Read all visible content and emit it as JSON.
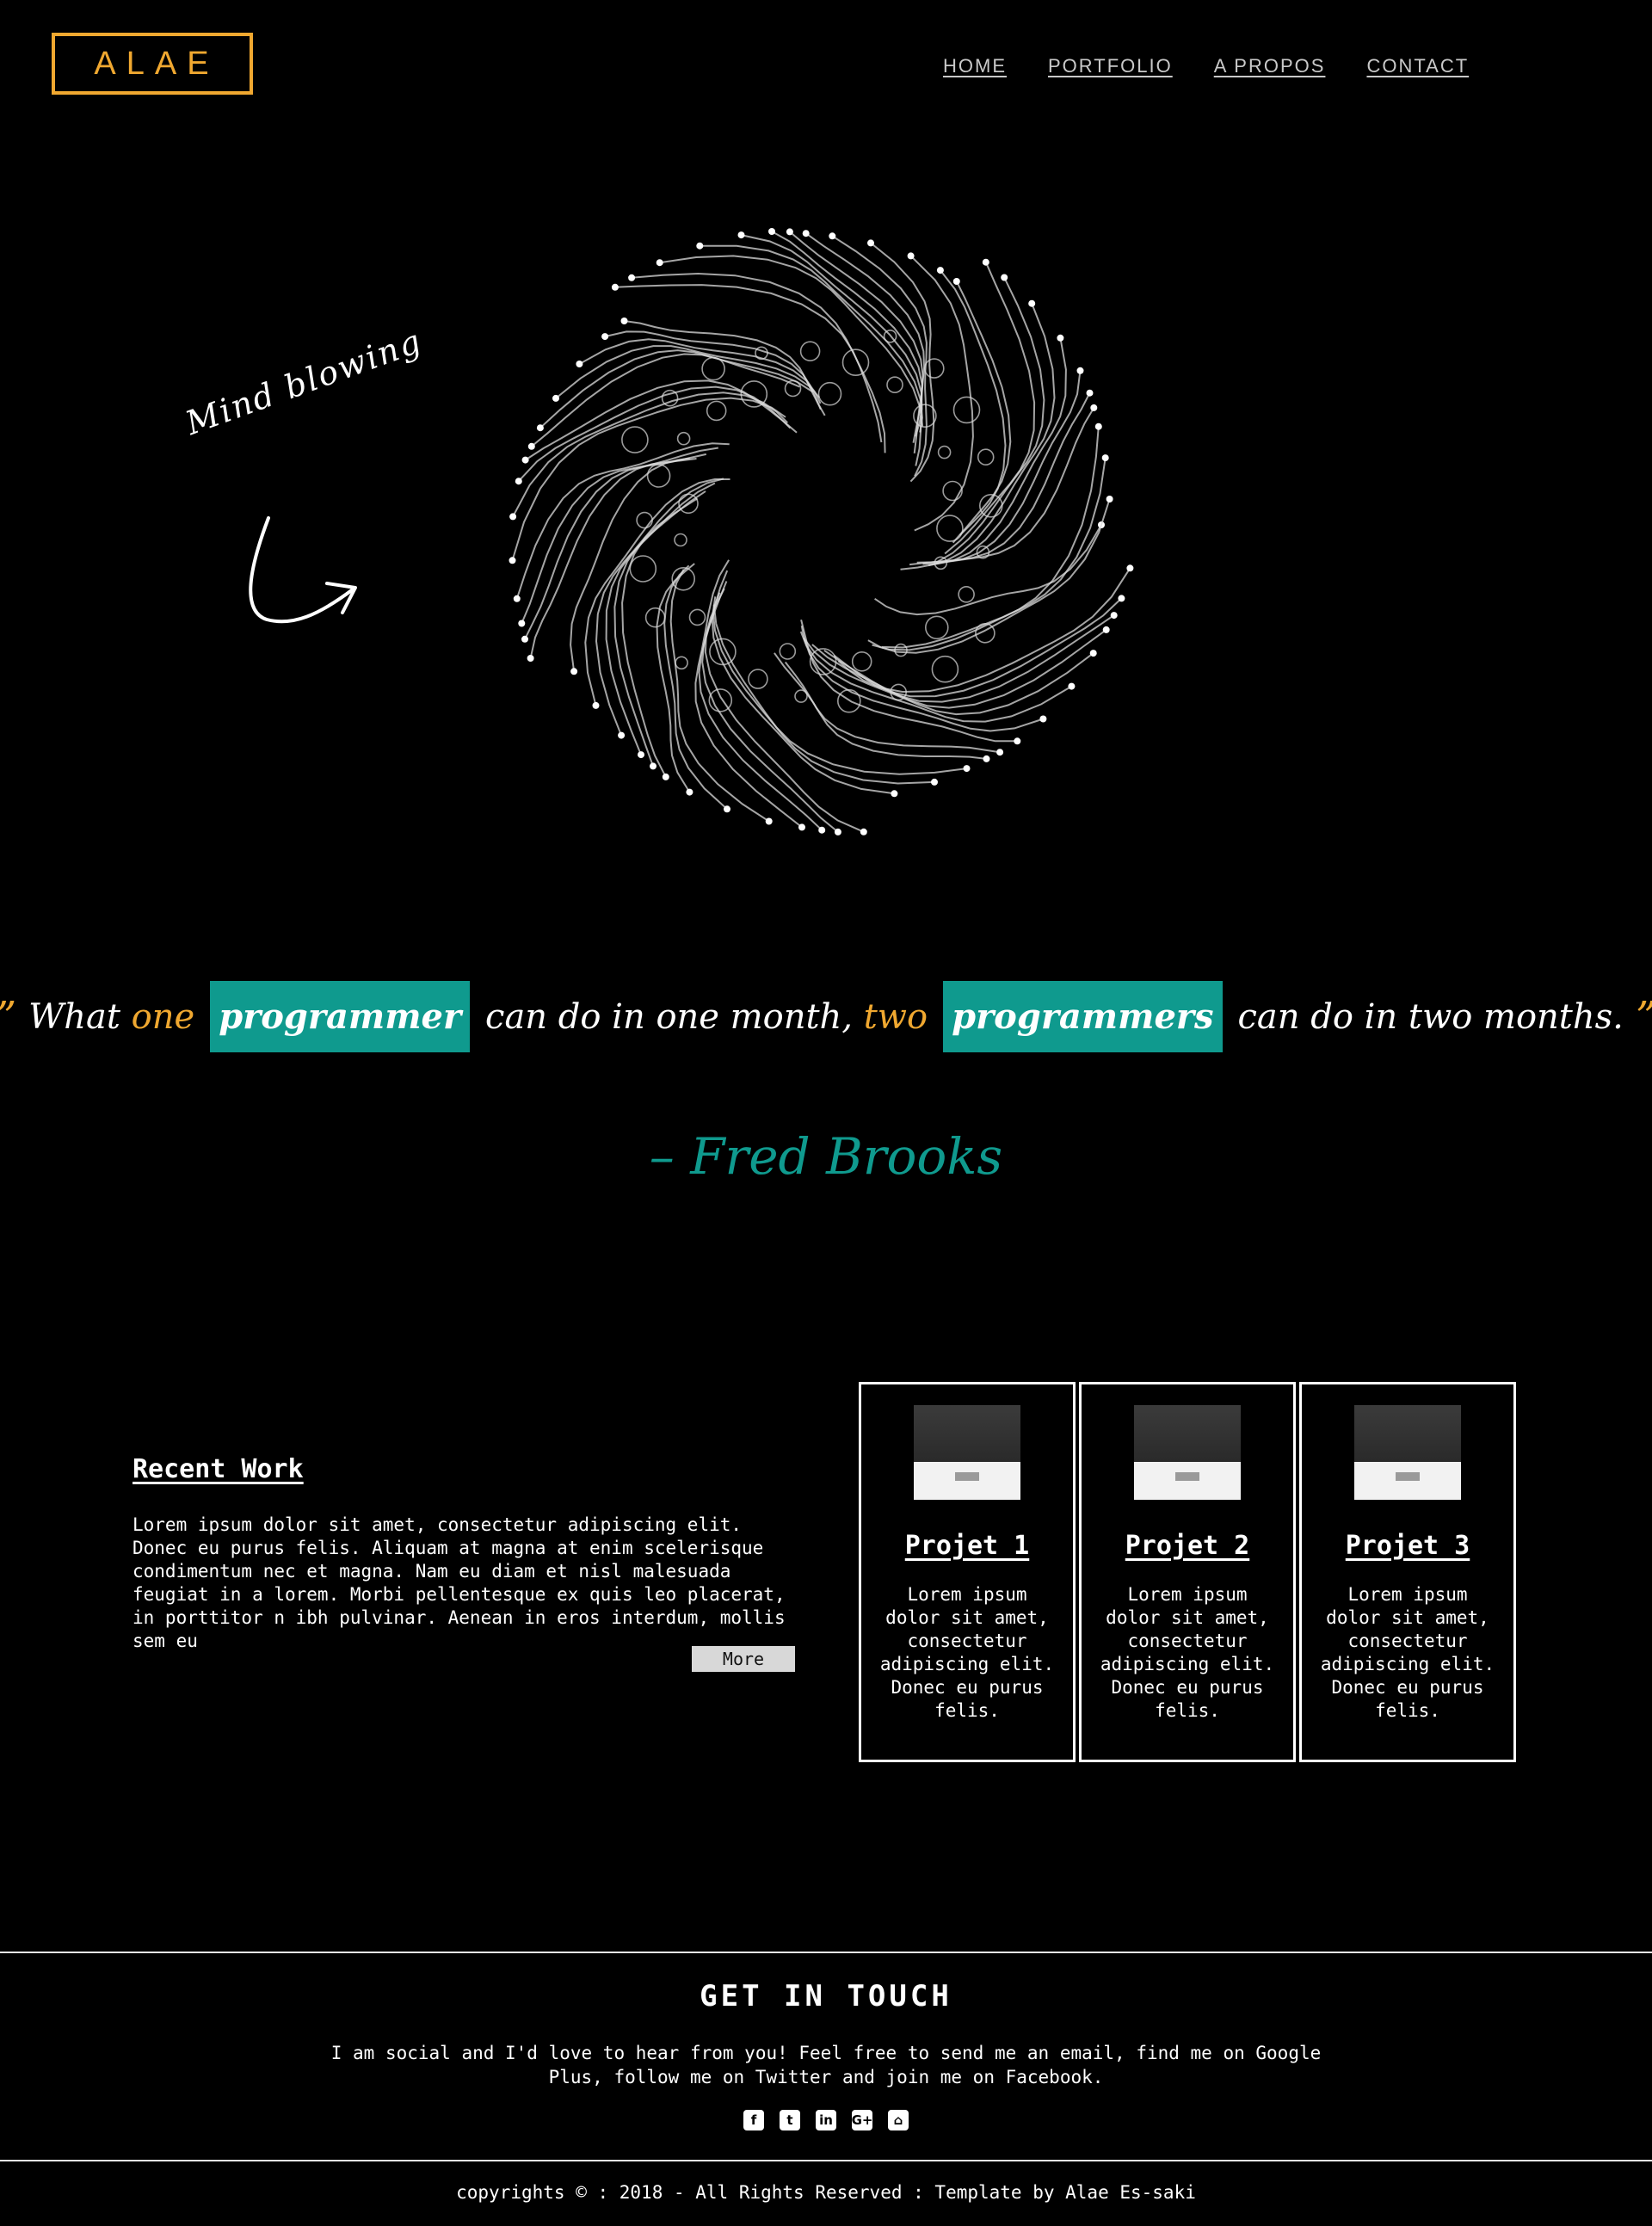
{
  "header": {
    "logo": "ALAE",
    "nav": [
      {
        "label": "HOME"
      },
      {
        "label": "PORTFOLIO"
      },
      {
        "label": "A PROPOS"
      },
      {
        "label": "CONTACT"
      }
    ]
  },
  "hero": {
    "annotation": "Mind blowing",
    "arrow_icon": "curved-arrow-icon",
    "graphic_icon": "particle-swirl-graphic"
  },
  "quote": {
    "open_mark": "”",
    "w1": "What",
    "w_one": "one",
    "box1": "programmer",
    "w2": "can do in one month,",
    "w_two": "two",
    "box2": "programmers",
    "w3": "can do in two months.",
    "close_mark": "”",
    "author": "– Fred Brooks",
    "accent_color": "#f0a830",
    "teal_color": "#0f9a8e"
  },
  "recent_work": {
    "title": "Recent Work",
    "text": "Lorem ipsum dolor sit amet, consectetur adipiscing elit. Donec eu purus felis. Aliquam at magna at enim scelerisque condimentum nec et magna. Nam eu diam et nisl malesuada feugiat in a lorem. Morbi pellentesque ex quis leo placerat, in porttitor n ibh pulvinar. Aenean in eros interdum, mollis sem eu",
    "more_label": "More"
  },
  "projects": [
    {
      "title": "Projet 1",
      "text": "Lorem ipsum dolor sit amet, consectetur adipiscing elit. Donec eu purus felis."
    },
    {
      "title": "Projet 2",
      "text": "Lorem ipsum dolor sit amet, consectetur adipiscing elit. Donec eu purus felis."
    },
    {
      "title": "Projet 3",
      "text": "Lorem ipsum dolor sit amet, consectetur adipiscing elit. Donec eu purus felis."
    }
  ],
  "footer": {
    "title": "GET IN TOUCH",
    "text": "I am social and I'd love to hear from you! Feel free to send me an email, find me on Google Plus, follow me on Twitter and join me on Facebook.",
    "socials": [
      {
        "icon": "facebook-icon",
        "glyph": "f"
      },
      {
        "icon": "twitter-icon",
        "glyph": "t"
      },
      {
        "icon": "linkedin-icon",
        "glyph": "in"
      },
      {
        "icon": "google-plus-icon",
        "glyph": "G+"
      },
      {
        "icon": "github-icon",
        "glyph": "⌂"
      }
    ],
    "copyright": "copyrights © : 2018 - All Rights Reserved : Template by Alae Es-saki"
  }
}
